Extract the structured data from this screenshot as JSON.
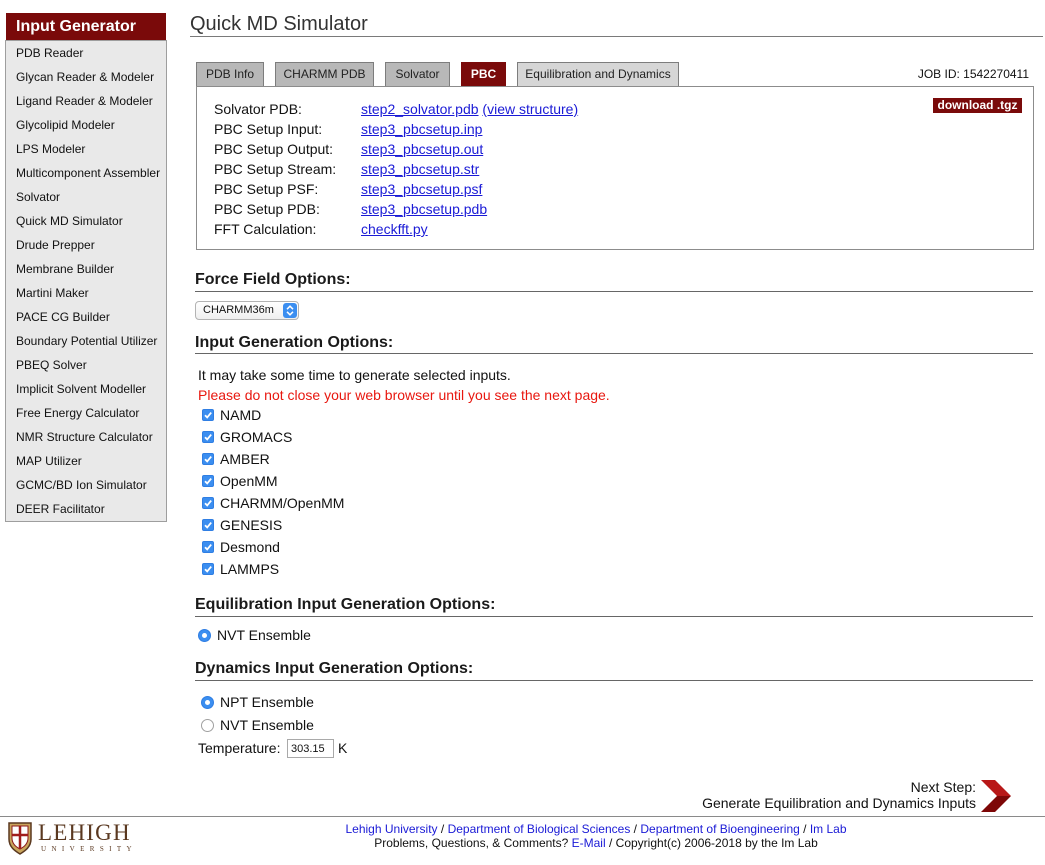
{
  "colors": {
    "accent": "#7a0a0a",
    "link": "#1a1ad6",
    "warning": "#e8170f",
    "control_blue": "#3b8ef0",
    "sidebar_bg": "#e9e9e9",
    "tab_bg": "#b8b8b8"
  },
  "icons": {
    "select": "select-chevron-icon",
    "checkbox": "checkmark-icon",
    "next": "next-arrow-icon",
    "logo": "lehigh-shield-icon"
  },
  "sidebar": {
    "header": "Input Generator",
    "items": [
      "PDB Reader",
      "Glycan Reader & Modeler",
      "Ligand Reader & Modeler",
      "Glycolipid Modeler",
      "LPS Modeler",
      "Multicomponent Assembler",
      "Solvator",
      "Quick MD Simulator",
      "Drude Prepper",
      "Membrane Builder",
      "Martini Maker",
      "PACE CG Builder",
      "Boundary Potential Utilizer",
      "PBEQ Solver",
      "Implicit Solvent Modeller",
      "Free Energy Calculator",
      "NMR Structure Calculator",
      "MAP Utilizer",
      "GCMC/BD Ion Simulator",
      "DEER Facilitator"
    ]
  },
  "page": {
    "title": "Quick MD Simulator"
  },
  "tabs": {
    "items": [
      "PDB Info",
      "CHARMM PDB",
      "Solvator",
      "PBC",
      "Equilibration and Dynamics"
    ],
    "active_index": 3
  },
  "job_id": "JOB ID: 1542270411",
  "panel": {
    "download_label": "download .tgz",
    "rows": [
      {
        "label": "Solvator PDB:",
        "file": "step2_solvator.pdb",
        "extra": "(view structure)"
      },
      {
        "label": "PBC Setup Input:",
        "file": "step3_pbcsetup.inp"
      },
      {
        "label": "PBC Setup Output:",
        "file": "step3_pbcsetup.out"
      },
      {
        "label": "PBC Setup Stream:",
        "file": "step3_pbcsetup.str"
      },
      {
        "label": "PBC Setup PSF:",
        "file": "step3_pbcsetup.psf"
      },
      {
        "label": "PBC Setup PDB:",
        "file": "step3_pbcsetup.pdb"
      },
      {
        "label": "FFT Calculation:",
        "file": "checkfft.py"
      }
    ]
  },
  "force_field": {
    "heading": "Force Field Options:",
    "selected": "CHARMM36m"
  },
  "input_generation": {
    "heading": "Input Generation Options:",
    "note": "It may take some time to generate selected inputs.",
    "warning": "Please do not close your web browser until you see the next page.",
    "options": [
      {
        "label": "NAMD",
        "checked": true
      },
      {
        "label": "GROMACS",
        "checked": true
      },
      {
        "label": "AMBER",
        "checked": true
      },
      {
        "label": "OpenMM",
        "checked": true
      },
      {
        "label": "CHARMM/OpenMM",
        "checked": true
      },
      {
        "label": "GENESIS",
        "checked": true
      },
      {
        "label": "Desmond",
        "checked": true
      },
      {
        "label": "LAMMPS",
        "checked": true
      }
    ]
  },
  "equilibration": {
    "heading": "Equilibration Input Generation Options:",
    "options": [
      {
        "label": "NVT Ensemble",
        "selected": true
      }
    ]
  },
  "dynamics": {
    "heading": "Dynamics Input Generation Options:",
    "options": [
      {
        "label": "NPT Ensemble",
        "selected": true
      },
      {
        "label": "NVT Ensemble",
        "selected": false
      }
    ],
    "temperature_label": "Temperature:",
    "temperature_value": "303.15",
    "temperature_unit": "K"
  },
  "next_step": {
    "label": "Next Step:",
    "action": "Generate Equilibration and Dynamics Inputs"
  },
  "footer": {
    "links": [
      "Lehigh University",
      "Department of Biological Sciences",
      "Department of Bioengineering",
      "Im Lab"
    ],
    "separator": "/",
    "help_prefix": "Problems, Questions, & Comments?",
    "email_label": "E-Mail",
    "copyright": "/ Copyright(c) 2006-2018 by the Im Lab"
  },
  "logo": {
    "name": "LEHIGH",
    "subtitle": "UNIVERSITY"
  }
}
